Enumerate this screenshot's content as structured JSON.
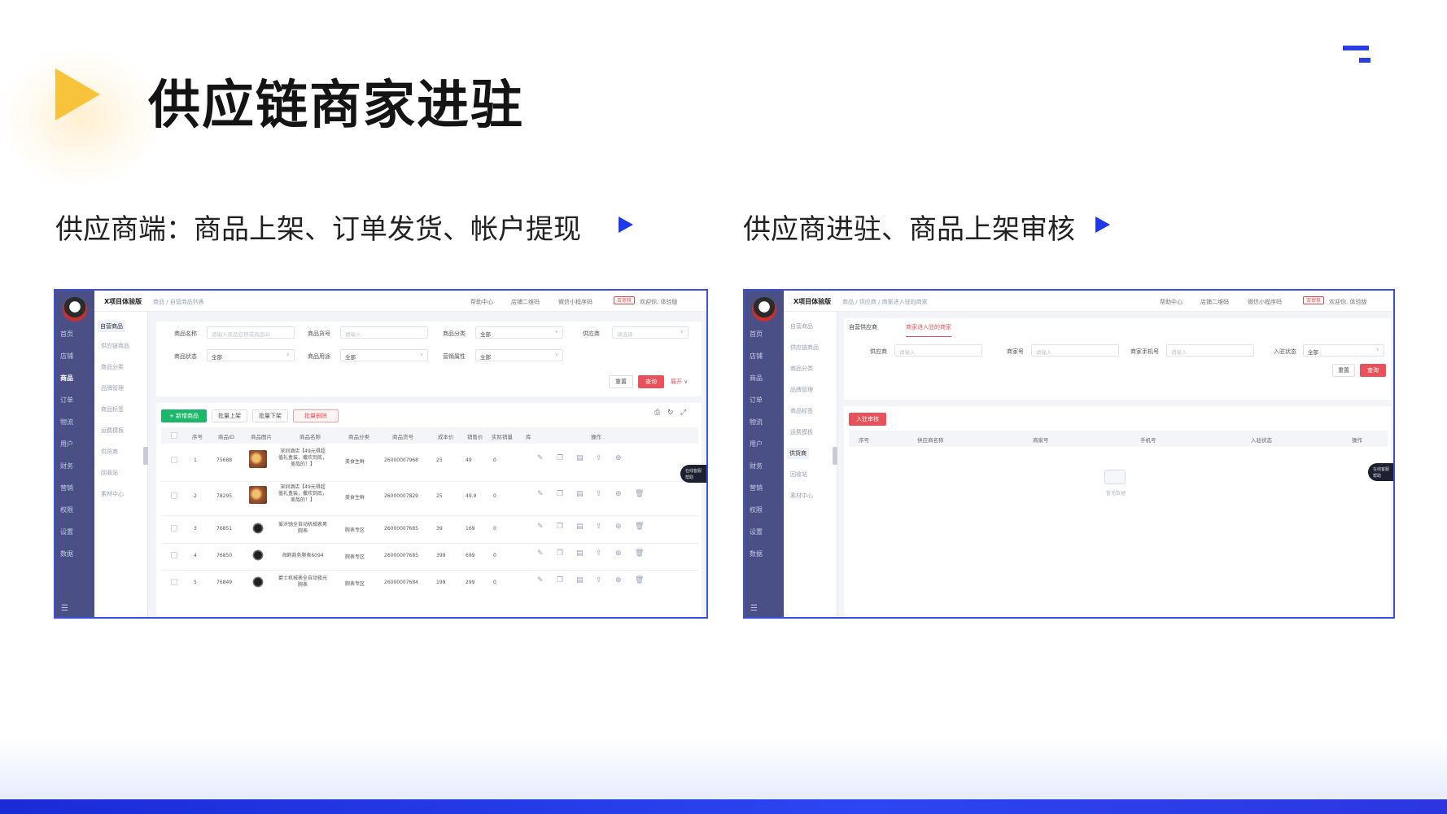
{
  "slide": {
    "title": "供应链商家进驻",
    "left_caption": "供应商端：商品上架、订单发货、帐户提现",
    "right_caption": "供应商进驻、商品上架审核"
  },
  "app": {
    "brand": "X项目体验版",
    "top_links": [
      "帮助中心",
      "店铺二维码",
      "微信小程序码"
    ],
    "top_badge": "去审核",
    "top_user": "欢迎你, 体验版",
    "sidebar": [
      "首页",
      "店铺",
      "商品",
      "订单",
      "物流",
      "用户",
      "财务",
      "营销",
      "权限",
      "设置",
      "数据"
    ]
  },
  "left_shot": {
    "breadcrumb": "商品 / 自营商品列表",
    "submenu": [
      "自营商品",
      "供应链商品",
      "商品分类",
      "品牌管理",
      "商品标签",
      "运费模板",
      "供货商",
      "回收站",
      "素材中心"
    ],
    "filters": [
      {
        "label": "商品名称",
        "placeholder": "请输入商品名称或商品ID"
      },
      {
        "label": "商品货号",
        "placeholder": "请输入"
      },
      {
        "label": "商品分类",
        "value": "全部"
      },
      {
        "label": "供应商",
        "placeholder": "请选择"
      },
      {
        "label": "商品状态",
        "value": "全部"
      },
      {
        "label": "商品用途",
        "value": "全部"
      },
      {
        "label": "营销属性",
        "value": "全部"
      }
    ],
    "reset_btn": "重置",
    "search_btn": "查询",
    "expand_link": "展开 ∨",
    "toolbar": {
      "add": "+ 新增商品",
      "on_shelf": "批量上架",
      "off_shelf": "批量下架",
      "delete": "批量删除"
    },
    "columns": [
      "序号",
      "商品ID",
      "商品图片",
      "商品名称",
      "商品分类",
      "商品货号",
      "成本价",
      "销售价",
      "实际销量",
      "库",
      "操作"
    ],
    "rows": [
      {
        "no": "1",
        "id": "75688",
        "name": "深圳酒店【49元得超值礼盒装，撒欢到底，美哉的！】",
        "category": "美食生鲜",
        "sku": "26000007968",
        "cost": "25",
        "price": "49",
        "sales": "0",
        "img": "food"
      },
      {
        "no": "2",
        "id": "78295",
        "name": "深圳酒店【49元得超值礼盒装，撒欢到底，美哉的！】",
        "category": "美食生鲜",
        "sku": "26000007829",
        "cost": "25",
        "price": "49.9",
        "sales": "0",
        "img": "food"
      },
      {
        "no": "3",
        "id": "76851",
        "name": "爱沃驰全自动机械表男腕表",
        "category": "腕表专区",
        "sku": "26000007685",
        "cost": "39",
        "price": "169",
        "sales": "0",
        "img": "watch"
      },
      {
        "no": "4",
        "id": "76850",
        "name": "海鸥商务腕表6094",
        "category": "腕表专区",
        "sku": "26000007685",
        "cost": "399",
        "price": "699",
        "sales": "0",
        "img": "watch"
      },
      {
        "no": "5",
        "id": "76849",
        "name": "爵士机械表全自动夜光腕表",
        "category": "腕表专区",
        "sku": "26000007684",
        "cost": "199",
        "price": "299",
        "sales": "0",
        "img": "watch"
      }
    ],
    "fab_lines": [
      "在线客服",
      "帮助"
    ]
  },
  "right_shot": {
    "breadcrumb": "商品 / 供应商 / 商家进入驻的商家",
    "submenu": [
      "自营商品",
      "供应链商品",
      "商品分类",
      "品牌管理",
      "商品标签",
      "运费模板",
      "供货商",
      "回收站",
      "素材中心"
    ],
    "tabs": [
      "自营供应商",
      "商家进入驻的商家"
    ],
    "filters": [
      {
        "label": "供应商",
        "placeholder": "请输入"
      },
      {
        "label": "商家号",
        "placeholder": "请输入"
      },
      {
        "label": "商家手机号",
        "placeholder": "请输入"
      },
      {
        "label": "入驻状态",
        "value": "全部"
      }
    ],
    "reset_btn": "重置",
    "search_btn": "查询",
    "audit_btn": "入驻审核",
    "columns": [
      "序号",
      "供应商名称",
      "商家号",
      "手机号",
      "入驻状态",
      "操作"
    ],
    "empty_text": "暂无数据",
    "fab_lines": [
      "在线客服",
      "帮助"
    ]
  }
}
